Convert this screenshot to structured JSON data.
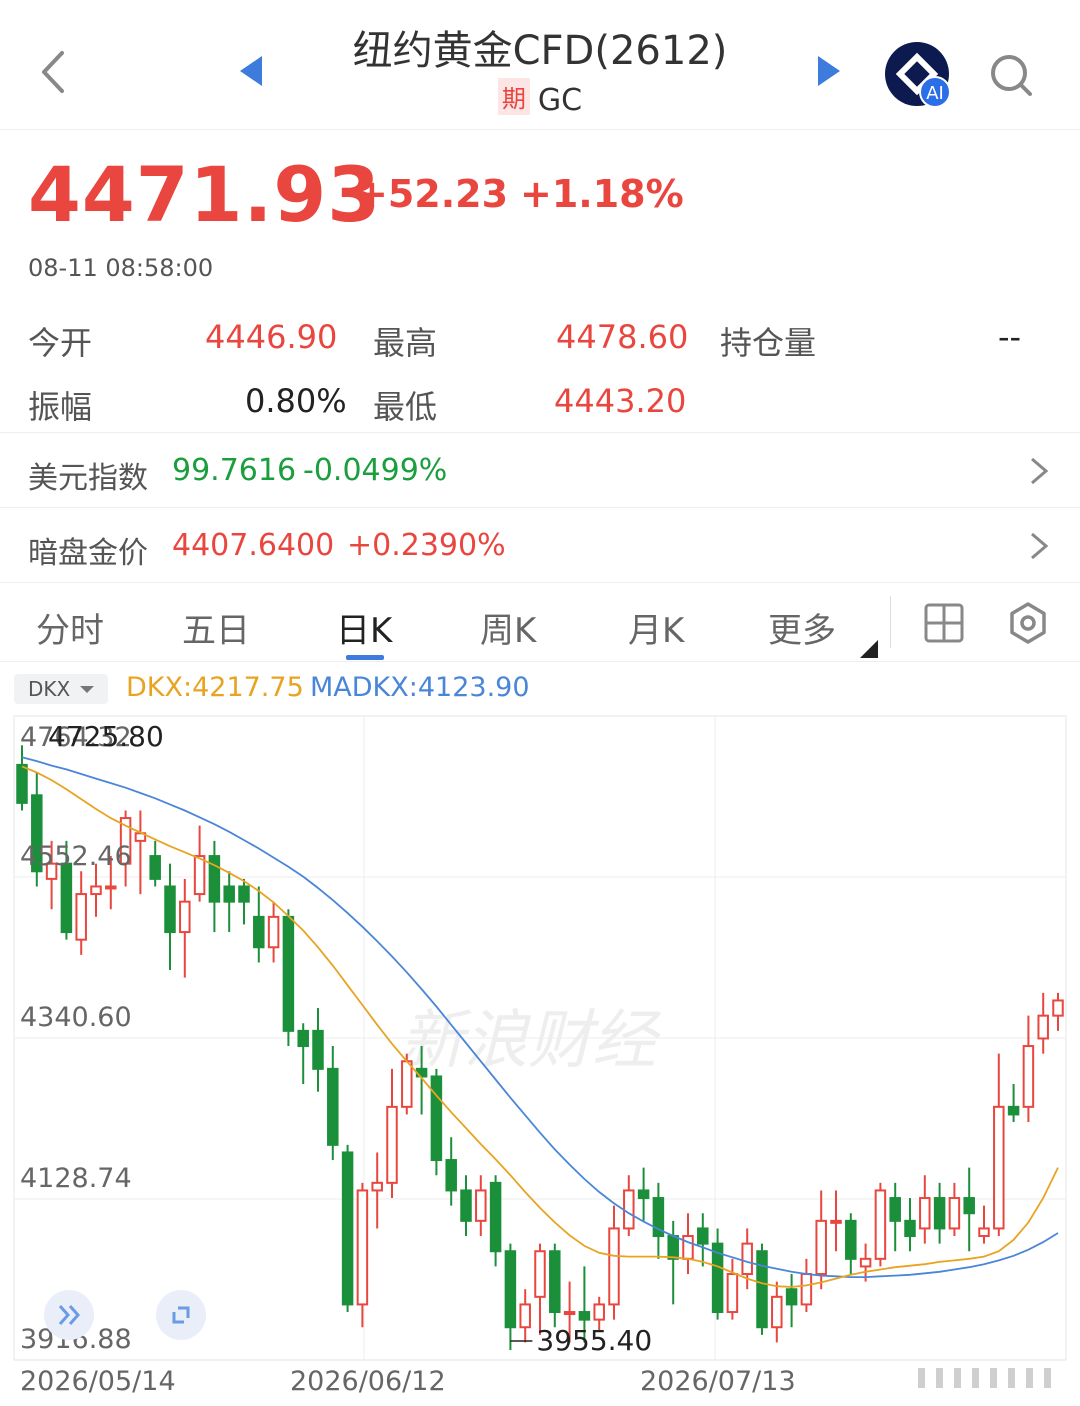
{
  "header": {
    "title": "纽约黄金CFD(2612)",
    "tag": "期",
    "code": "GC",
    "ai_badge": "AI"
  },
  "quote": {
    "price": "4471.93",
    "change": "+52.23",
    "change_pct": "+1.18%",
    "time": "08-11 08:58:00"
  },
  "stats": {
    "open_label": "今开",
    "open": "4446.90",
    "high_label": "最高",
    "high": "4478.60",
    "oi_label": "持仓量",
    "oi": "--",
    "amp_label": "振幅",
    "amp": "0.80%",
    "low_label": "最低",
    "low": "4443.20"
  },
  "rows": [
    {
      "label": "美元指数",
      "value": "99.7616",
      "pct": "-0.0499%"
    },
    {
      "label": "暗盘金价",
      "value": "4407.6400",
      "pct": "+0.2390%"
    }
  ],
  "tabs": [
    "分时",
    "五日",
    "日K",
    "周K",
    "月K",
    "更多"
  ],
  "indicator": {
    "selector": "DKX",
    "dkx": "DKX:4217.75",
    "madkx": "MADKX:4123.90"
  },
  "colors": {
    "up": "#e8463e",
    "down": "#1b8f3a",
    "dkx": "#e8a320",
    "madkx": "#4a86d8",
    "accent": "#3d7bdc"
  },
  "chart_data": {
    "type": "candlestick",
    "y_ticks": [
      "4764.32",
      "4552.46",
      "4340.60",
      "4128.74",
      "3916.88"
    ],
    "x_ticks": [
      "2026/05/14",
      "2026/06/12",
      "2026/07/13"
    ],
    "max_label": "4725.80",
    "min_label": "3955.40",
    "watermark": "新浪财经",
    "ylim": [
      3916.88,
      4764.32
    ],
    "candles": [
      [
        4700,
        4650,
        4725.8,
        4640
      ],
      [
        4660,
        4560,
        4690,
        4540
      ],
      [
        4550,
        4570,
        4600,
        4510
      ],
      [
        4570,
        4480,
        4600,
        4470
      ],
      [
        4470,
        4530,
        4560,
        4450
      ],
      [
        4530,
        4540,
        4570,
        4500
      ],
      [
        4540,
        4540,
        4580,
        4510
      ],
      [
        4570,
        4630,
        4640,
        4540
      ],
      [
        4600,
        4610,
        4640,
        4530
      ],
      [
        4580,
        4550,
        4600,
        4540
      ],
      [
        4540,
        4480,
        4570,
        4430
      ],
      [
        4480,
        4520,
        4550,
        4420
      ],
      [
        4530,
        4580,
        4620,
        4520
      ],
      [
        4580,
        4520,
        4600,
        4480
      ],
      [
        4540,
        4520,
        4560,
        4480
      ],
      [
        4540,
        4520,
        4550,
        4490
      ],
      [
        4500,
        4460,
        4540,
        4440
      ],
      [
        4460,
        4500,
        4520,
        4440
      ],
      [
        4500,
        4350,
        4510,
        4330
      ],
      [
        4350,
        4330,
        4360,
        4280
      ],
      [
        4350,
        4300,
        4380,
        4270
      ],
      [
        4300,
        4200,
        4330,
        4180
      ],
      [
        4190,
        3990,
        4200,
        3980
      ],
      [
        3990,
        4140,
        4150,
        3960
      ],
      [
        4140,
        4150,
        4190,
        4090
      ],
      [
        4150,
        4250,
        4300,
        4130
      ],
      [
        4250,
        4310,
        4320,
        4240
      ],
      [
        4300,
        4290,
        4330,
        4240
      ],
      [
        4290,
        4180,
        4300,
        4160
      ],
      [
        4180,
        4140,
        4210,
        4120
      ],
      [
        4140,
        4100,
        4160,
        4080
      ],
      [
        4100,
        4140,
        4160,
        4080
      ],
      [
        4150,
        4060,
        4160,
        4040
      ],
      [
        4060,
        3960,
        4070,
        3930
      ],
      [
        3960,
        3990,
        4010,
        3940
      ],
      [
        4000,
        4060,
        4070,
        3950
      ],
      [
        4060,
        3980,
        4070,
        3960
      ],
      [
        3980,
        3980,
        4020,
        3940
      ],
      [
        3980,
        3970,
        4040,
        3940
      ],
      [
        3970,
        3990,
        4000,
        3955.4
      ],
      [
        3990,
        4090,
        4120,
        3970
      ],
      [
        4090,
        4140,
        4160,
        4080
      ],
      [
        4140,
        4130,
        4170,
        4100
      ],
      [
        4130,
        4080,
        4150,
        4050
      ],
      [
        4080,
        4050,
        4100,
        3990
      ],
      [
        4050,
        4080,
        4110,
        4030
      ],
      [
        4090,
        4070,
        4110,
        4040
      ],
      [
        4070,
        3980,
        4090,
        3970
      ],
      [
        3980,
        4030,
        4050,
        3970
      ],
      [
        4030,
        4070,
        4090,
        4010
      ],
      [
        4060,
        3960,
        4070,
        3950
      ],
      [
        3960,
        4000,
        4020,
        3940
      ],
      [
        4010,
        3990,
        4030,
        3960
      ],
      [
        3990,
        4030,
        4050,
        3980
      ],
      [
        4030,
        4100,
        4140,
        4010
      ],
      [
        4100,
        4100,
        4140,
        4060
      ],
      [
        4100,
        4050,
        4110,
        4030
      ],
      [
        4040,
        4050,
        4070,
        4020
      ],
      [
        4050,
        4140,
        4150,
        4040
      ],
      [
        4130,
        4100,
        4150,
        4060
      ],
      [
        4100,
        4080,
        4130,
        4060
      ],
      [
        4090,
        4130,
        4160,
        4070
      ],
      [
        4130,
        4090,
        4150,
        4070
      ],
      [
        4090,
        4130,
        4150,
        4080
      ],
      [
        4130,
        4110,
        4170,
        4060
      ],
      [
        4080,
        4090,
        4120,
        4070
      ],
      [
        4090,
        4250,
        4320,
        4080
      ],
      [
        4250,
        4240,
        4280,
        4230
      ],
      [
        4250,
        4330,
        4370,
        4230
      ],
      [
        4340,
        4370,
        4400,
        4320
      ],
      [
        4370,
        4390,
        4400,
        4350
      ]
    ],
    "dkx": [
      4698,
      4690,
      4680,
      4668,
      4655,
      4642,
      4630,
      4620,
      4611,
      4602,
      4593,
      4585,
      4577,
      4568,
      4558,
      4547,
      4534,
      4519,
      4501,
      4482,
      4460,
      4436,
      4410,
      4384,
      4358,
      4333,
      4310,
      4288,
      4265,
      4243,
      4222,
      4201,
      4181,
      4160,
      4138,
      4117,
      4098,
      4081,
      4067,
      4058,
      4054,
      4053,
      4053,
      4053,
      4052,
      4050,
      4046,
      4040,
      4032,
      4024,
      4018,
      4014,
      4013,
      4015,
      4019,
      4024,
      4029,
      4033,
      4036,
      4039,
      4041,
      4043,
      4046,
      4048,
      4050,
      4053,
      4060,
      4075,
      4098,
      4130,
      4170
    ],
    "madkx": [
      4710,
      4705,
      4699,
      4694,
      4688,
      4682,
      4676,
      4670,
      4663,
      4656,
      4648,
      4640,
      4631,
      4622,
      4612,
      4601,
      4590,
      4578,
      4566,
      4553,
      4538,
      4522,
      4505,
      4487,
      4468,
      4448,
      4427,
      4405,
      4382,
      4358,
      4334,
      4310,
      4286,
      4262,
      4239,
      4216,
      4194,
      4174,
      4155,
      4138,
      4123,
      4110,
      4099,
      4089,
      4080,
      4072,
      4065,
      4058,
      4052,
      4046,
      4041,
      4037,
      4033,
      4030,
      4028,
      4027,
      4026,
      4026,
      4027,
      4028,
      4029,
      4031,
      4033,
      4036,
      4039,
      4043,
      4048,
      4054,
      4062,
      4072,
      4084
    ]
  }
}
